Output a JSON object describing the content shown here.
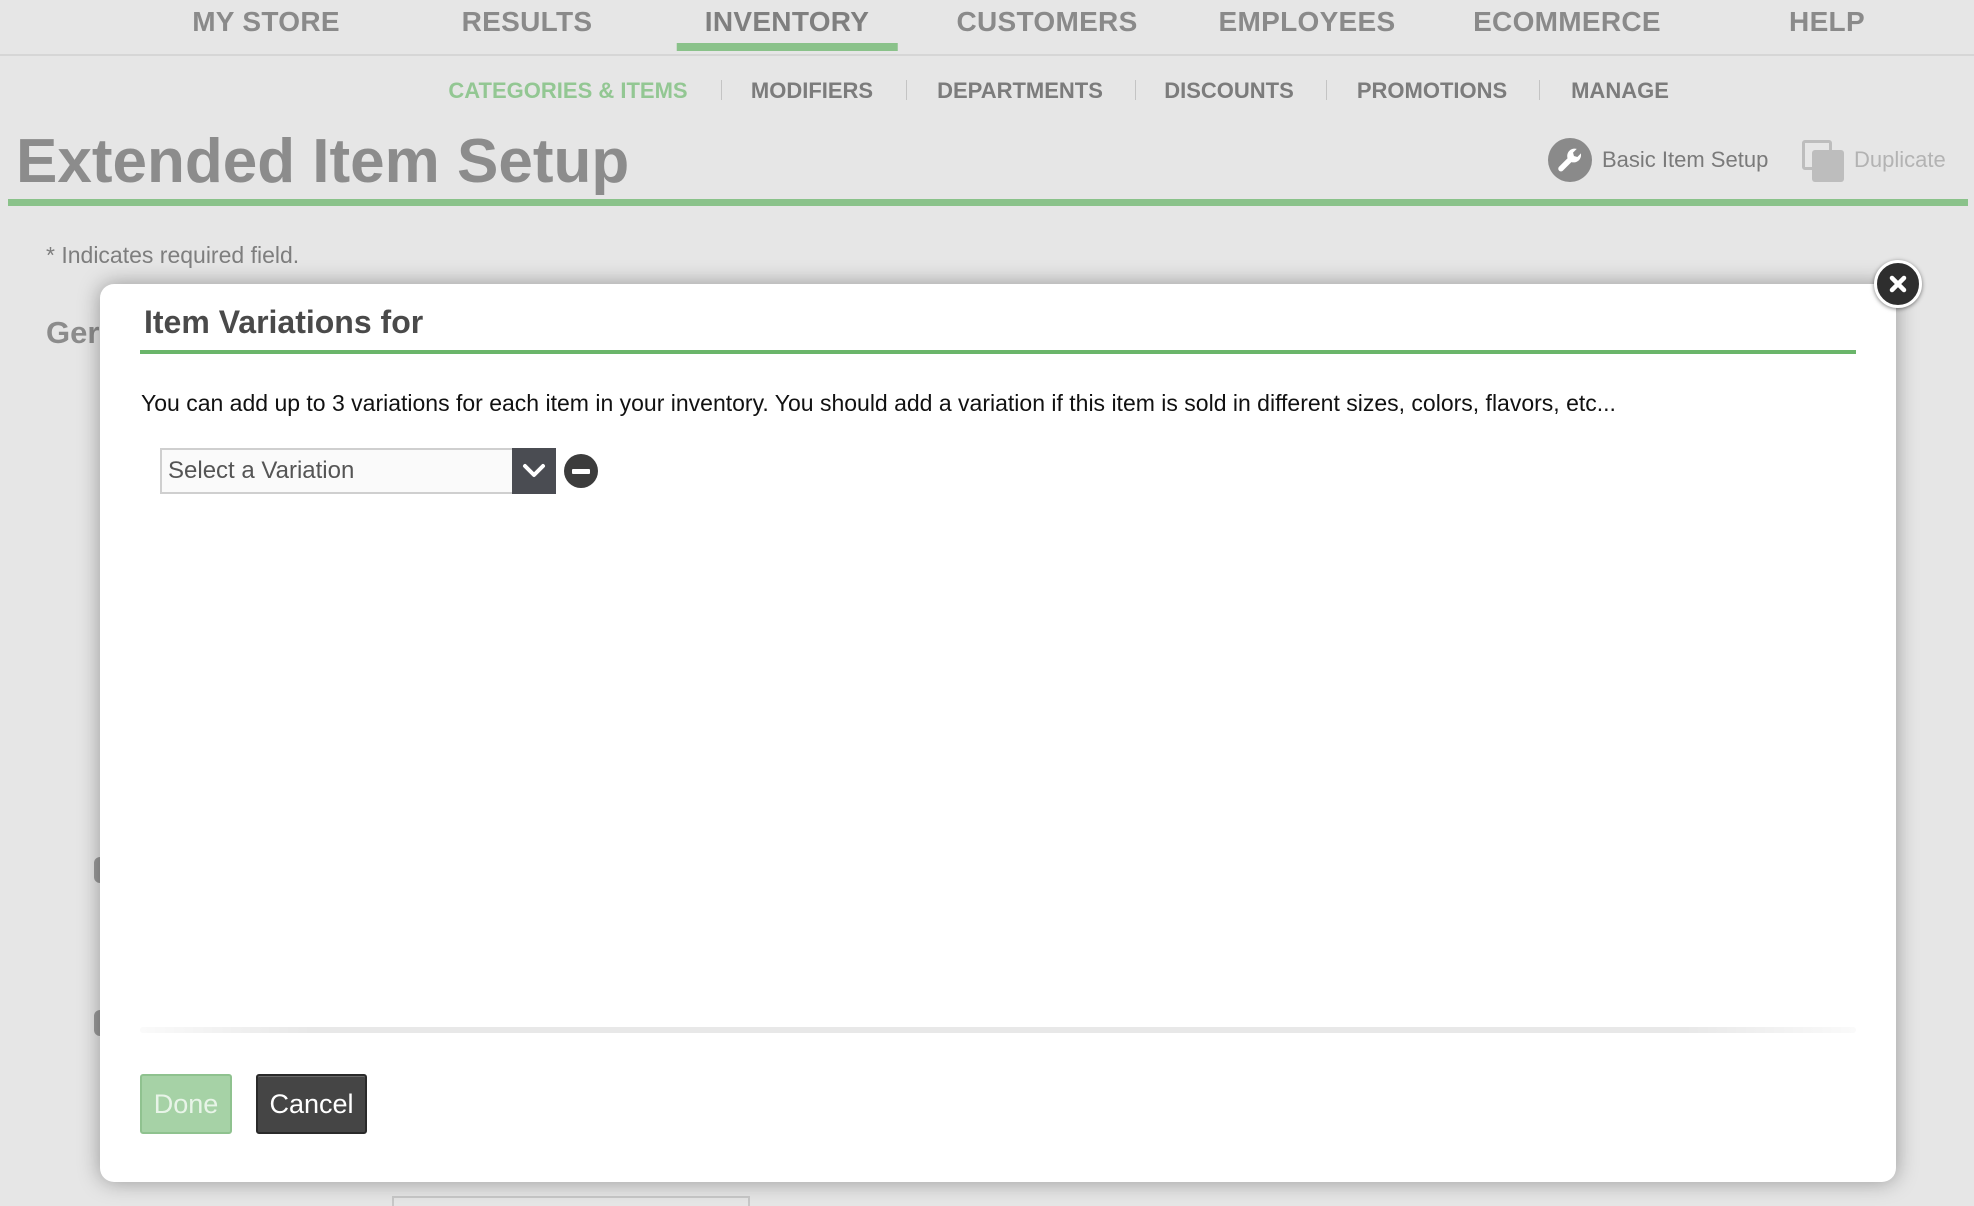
{
  "main_nav": {
    "items": [
      {
        "label": "MY STORE"
      },
      {
        "label": "RESULTS"
      },
      {
        "label": "INVENTORY"
      },
      {
        "label": "CUSTOMERS"
      },
      {
        "label": "EMPLOYEES"
      },
      {
        "label": "ECOMMERCE"
      },
      {
        "label": "HELP"
      }
    ],
    "active": "INVENTORY"
  },
  "sub_nav": {
    "items": [
      {
        "label": "CATEGORIES & ITEMS"
      },
      {
        "label": "MODIFIERS"
      },
      {
        "label": "DEPARTMENTS"
      },
      {
        "label": "DISCOUNTS"
      },
      {
        "label": "PROMOTIONS"
      },
      {
        "label": "MANAGE"
      }
    ],
    "active": "CATEGORIES & ITEMS"
  },
  "page": {
    "title": "Extended Item Setup",
    "actions": {
      "basic_item_setup": {
        "label": "Basic Item Setup",
        "icon": "wrench-icon"
      },
      "duplicate": {
        "label": "Duplicate",
        "icon": "duplicate-icon",
        "disabled": true
      }
    },
    "required_note": "* Indicates required field.",
    "section_heading_partial": "Ger"
  },
  "modal": {
    "title": "Item Variations for",
    "description": "You can add up to 3 variations for each item in your inventory. You should add a variation if this item is sold in different sizes, colors, flavors, etc...",
    "variation_select": {
      "value": "Select a Variation",
      "dropdown_icon": "chevron-down-icon",
      "remove_icon": "minus-circle-icon"
    },
    "close_icon": "close-icon",
    "buttons": {
      "done": {
        "label": "Done",
        "disabled": true
      },
      "cancel": {
        "label": "Cancel"
      }
    }
  },
  "colors": {
    "accent_green": "#8ac28a",
    "modal_rule_green": "#6ab56a",
    "done_button": "#a6d2a6",
    "cancel_button": "#454545",
    "background": "#e6e6e6"
  }
}
